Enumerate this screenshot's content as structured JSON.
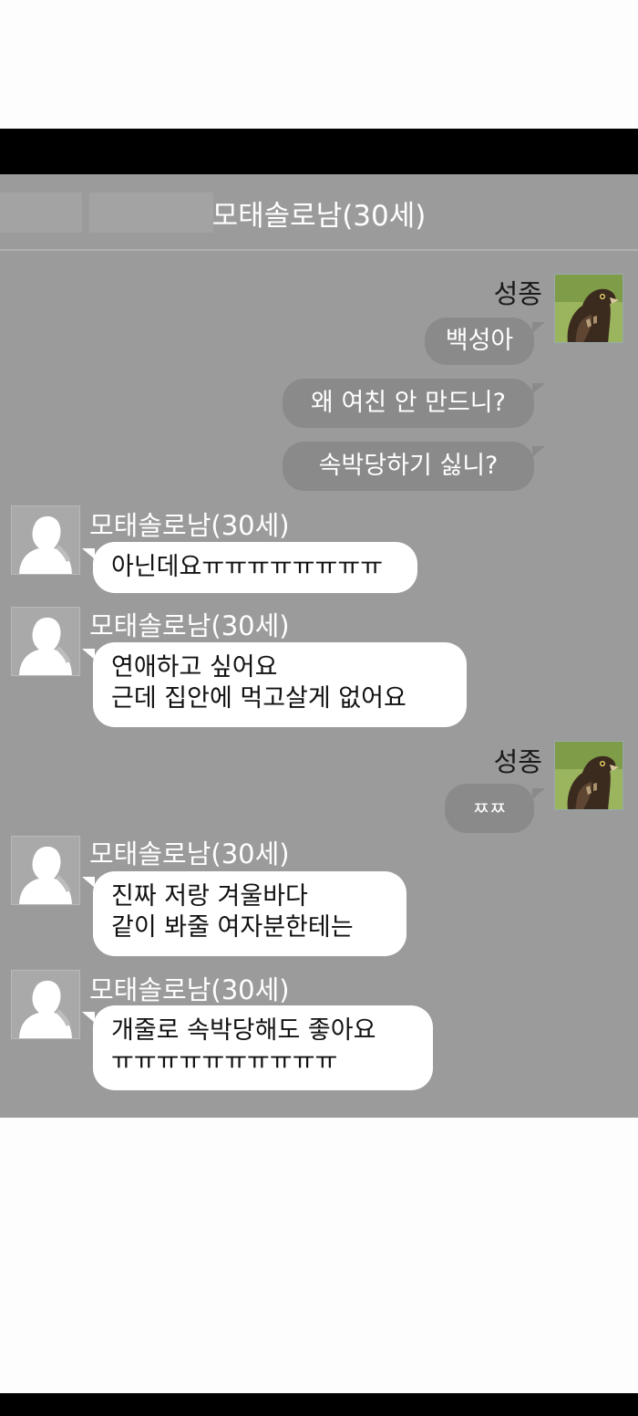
{
  "chat": {
    "title": "모태솔로남(30세)",
    "me_name": "성종",
    "other_name": "모태솔로남(30세)",
    "messages": {
      "m1": "백성아",
      "m2": "왜 여친 안 만드니?",
      "m3": "속박당하기 싫니?",
      "o1": "아닌데요ㅠㅠㅠㅠㅠㅠㅠㅠ",
      "o2_line1": "연애하고 싶어요",
      "o2_line2": "근데 집안에 먹고살게 없어요",
      "m4": "ㅉㅉ",
      "o3_line1": "진짜 저랑 겨울바다",
      "o3_line2": "같이 봐줄 여자분한테는",
      "o4_line1": "개줄로 속박당해도 좋아요",
      "o4_line2": "ㅠㅠㅠㅠㅠㅠㅠㅠㅠㅠ"
    }
  },
  "icons": {
    "me_avatar": "hawk-photo-avatar",
    "other_avatar": "default-profile-silhouette-icon"
  },
  "colors": {
    "chat_background": "#9b9b9b",
    "my_bubble": "#8a8a8a",
    "other_bubble": "#ffffff"
  }
}
